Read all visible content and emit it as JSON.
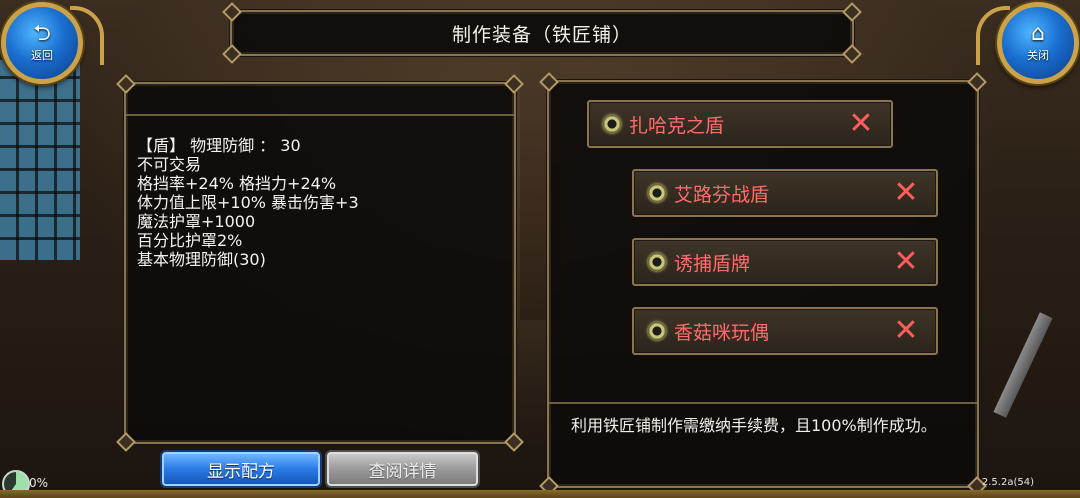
{
  "header": {
    "title": "制作装备（铁匠铺）",
    "back": {
      "icon": "back-arrow-icon",
      "label": "返回"
    },
    "close": {
      "icon": "home-icon",
      "label": "关闭"
    }
  },
  "item_stats": {
    "lines": [
      "【盾】 物理防御 ：  30",
      "不可交易",
      "格挡率+24% 格挡力+24%",
      "体力值上限+10% 暴击伤害+3",
      "魔法护罩+1000",
      "百分比护罩2%",
      "基本物理防御(30)"
    ]
  },
  "recipes": [
    {
      "name": "扎哈克之盾",
      "remove": "✕"
    },
    {
      "name": "艾路芬战盾",
      "remove": "✕"
    },
    {
      "name": "诱捕盾牌",
      "remove": "✕"
    },
    {
      "name": "香菇咪玩偶",
      "remove": "✕"
    }
  ],
  "note": "利用铁匠铺制作需缴纳手续费，且100%制作成功。",
  "buttons": {
    "show_recipe": "显示配方",
    "view_details": "查阅详情"
  },
  "status": {
    "progress": "0%",
    "version": "2.5.2a(54)"
  },
  "colors": {
    "recipe_text": "#ff6b6b",
    "primary_button": "#2a7be6",
    "frame_border": "#8a7550"
  }
}
